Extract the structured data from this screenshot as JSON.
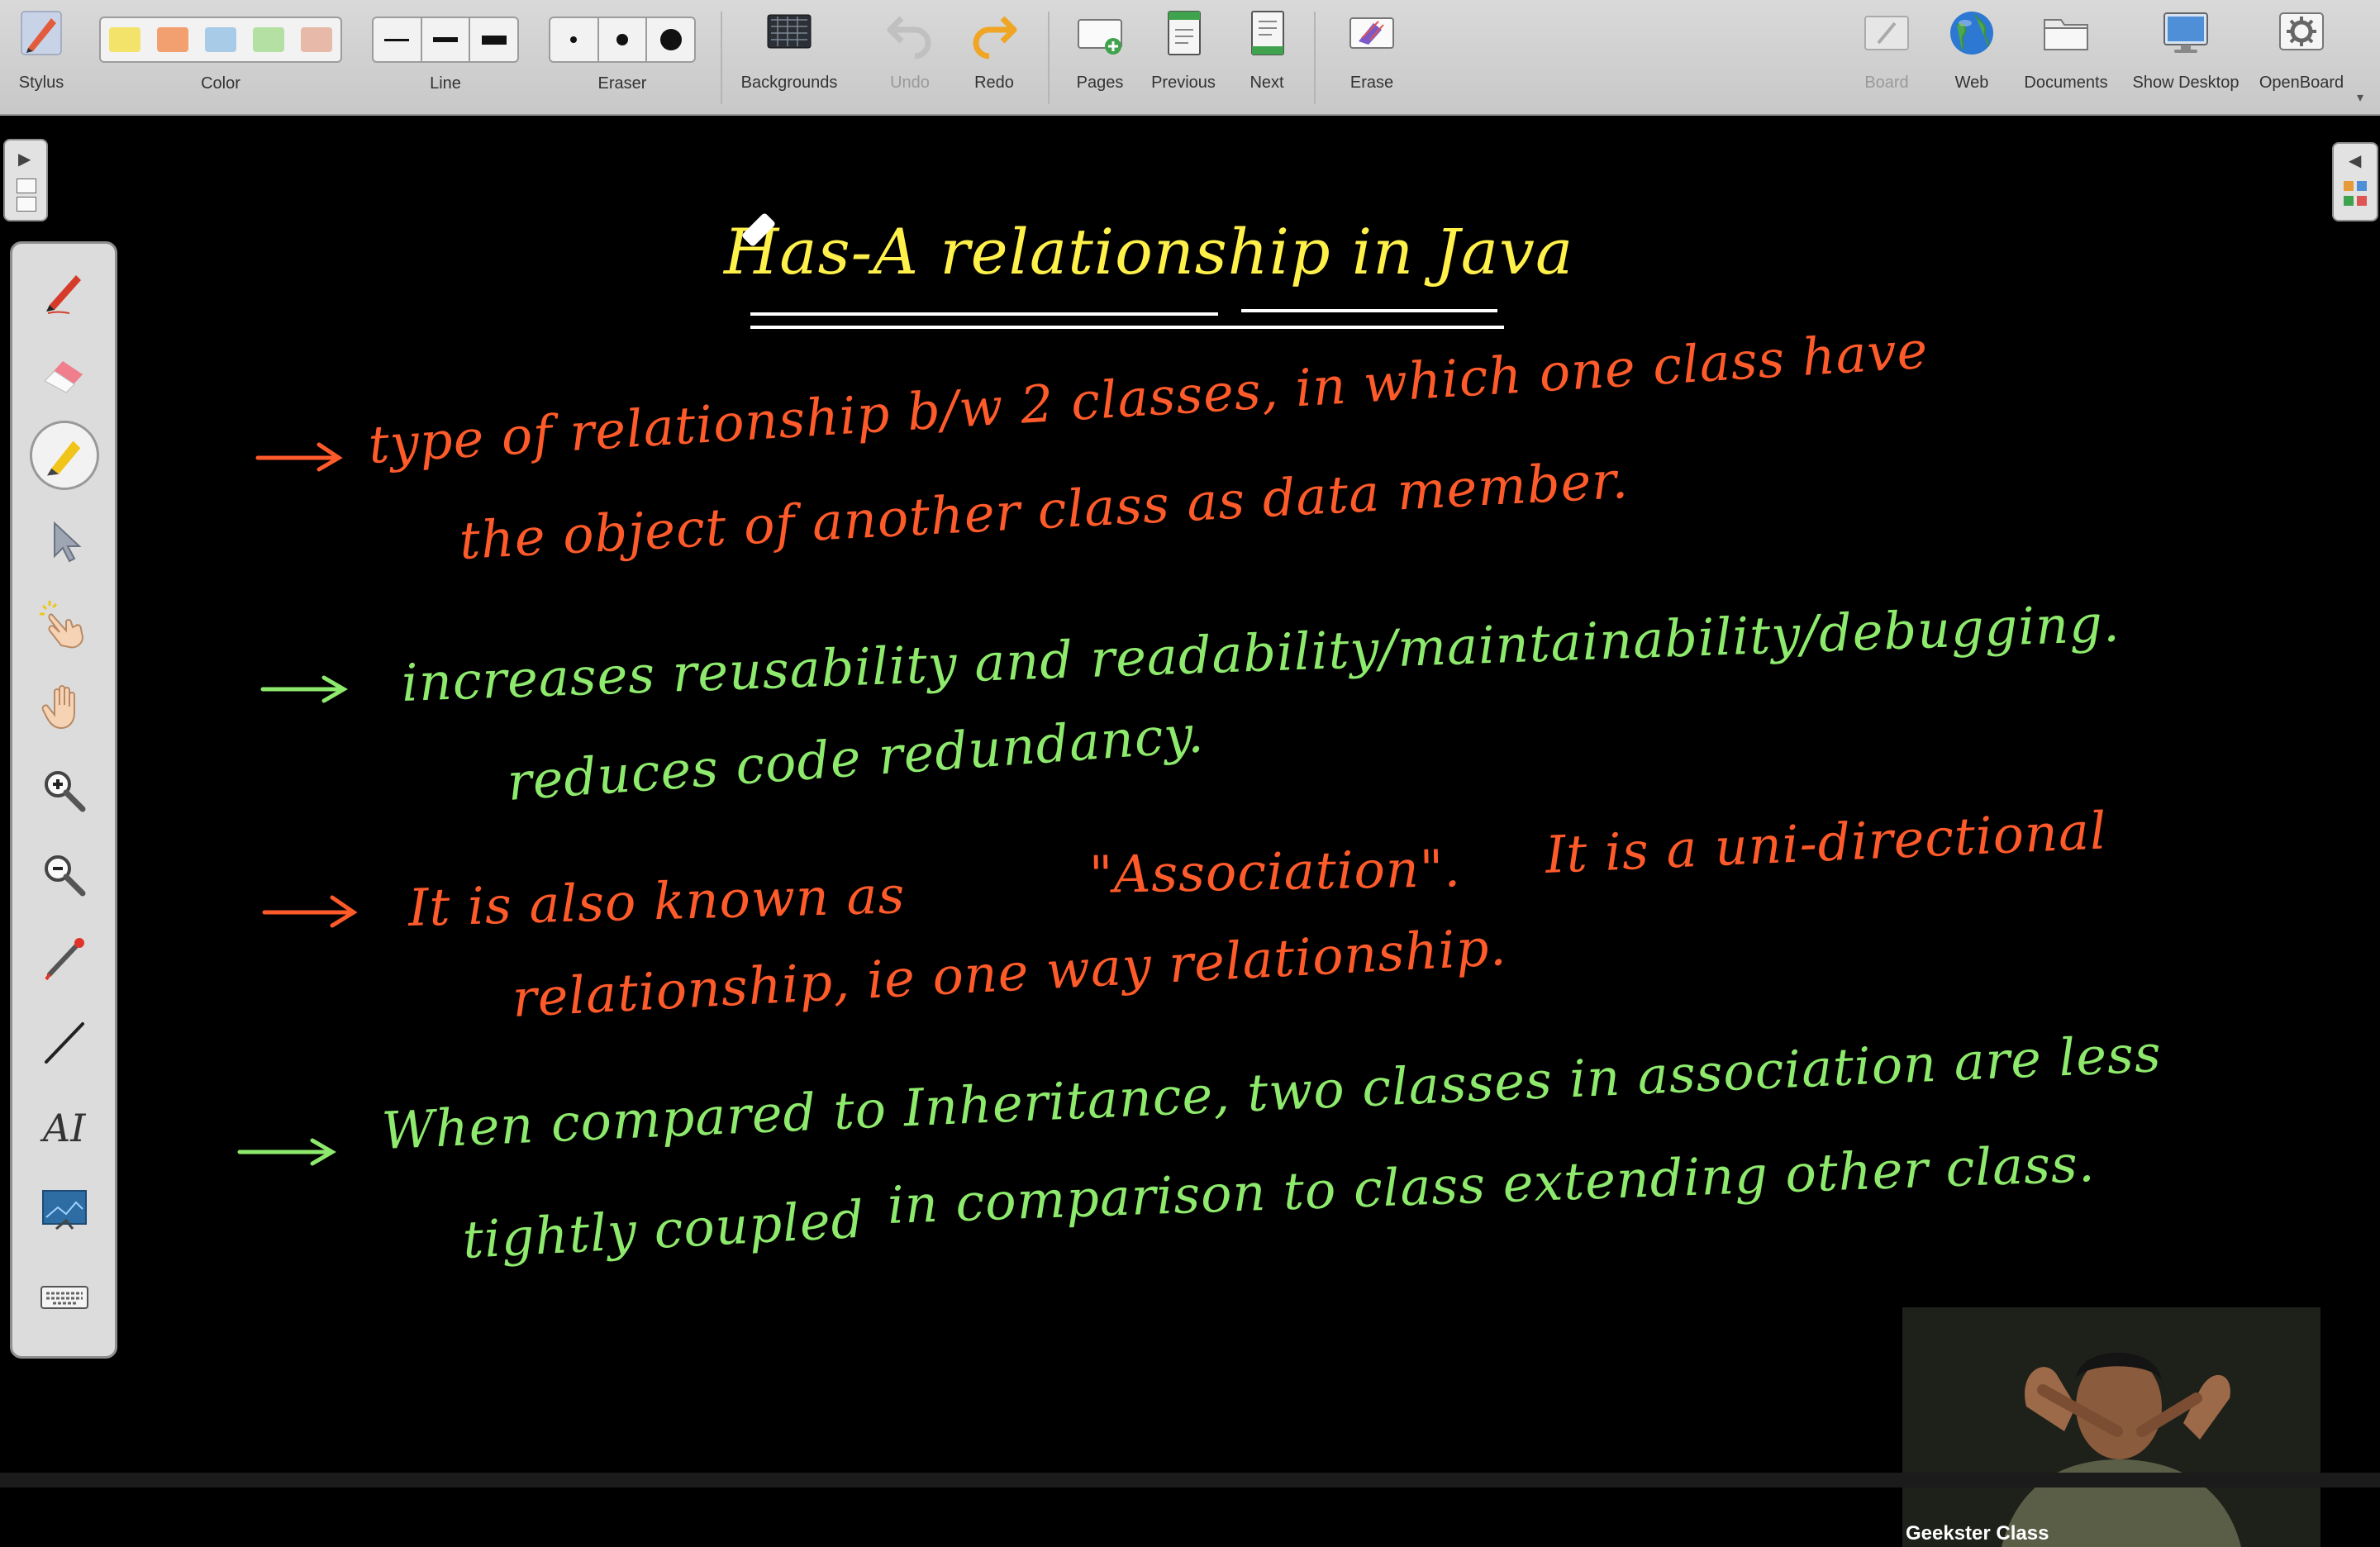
{
  "toolbar": {
    "stylus": "Stylus",
    "color": "Color",
    "line": "Line",
    "eraser": "Eraser",
    "backgrounds": "Backgrounds",
    "undo": "Undo",
    "redo": "Redo",
    "pages": "Pages",
    "previous": "Previous",
    "next": "Next",
    "erase": "Erase",
    "board": "Board",
    "web": "Web",
    "documents": "Documents",
    "show_desktop": "Show Desktop",
    "openboard": "OpenBoard"
  },
  "colors": {
    "swatches": [
      "#f3e36a",
      "#f3a070",
      "#a8cbe8",
      "#b5e0a3",
      "#e7b9a8"
    ],
    "title": "#fff04a",
    "orange": "#ff5a2a",
    "green": "#8eea6c"
  },
  "board": {
    "title": "Has-A relationship in Java",
    "p1_l1": "type of relationship b/w 2 classes, in which one class have",
    "p1_l2": "the object of another class as data member.",
    "p2_l1": "increases reusability and readability/maintainability/debugging.",
    "p2_l2": "reduces code redundancy.",
    "p3_l1a": "It is also known as",
    "p3_l1b": "\"Association\".",
    "p3_l1c": "It is a uni-directional",
    "p3_l2": "relationship, ie one way relationship.",
    "p4_l1": "When compared to Inheritance, two classes in association are less",
    "p4_l2a": "tightly coupled",
    "p4_l2b": "in comparison to class extending other class."
  },
  "webcam": {
    "label": "Geekster Class"
  }
}
